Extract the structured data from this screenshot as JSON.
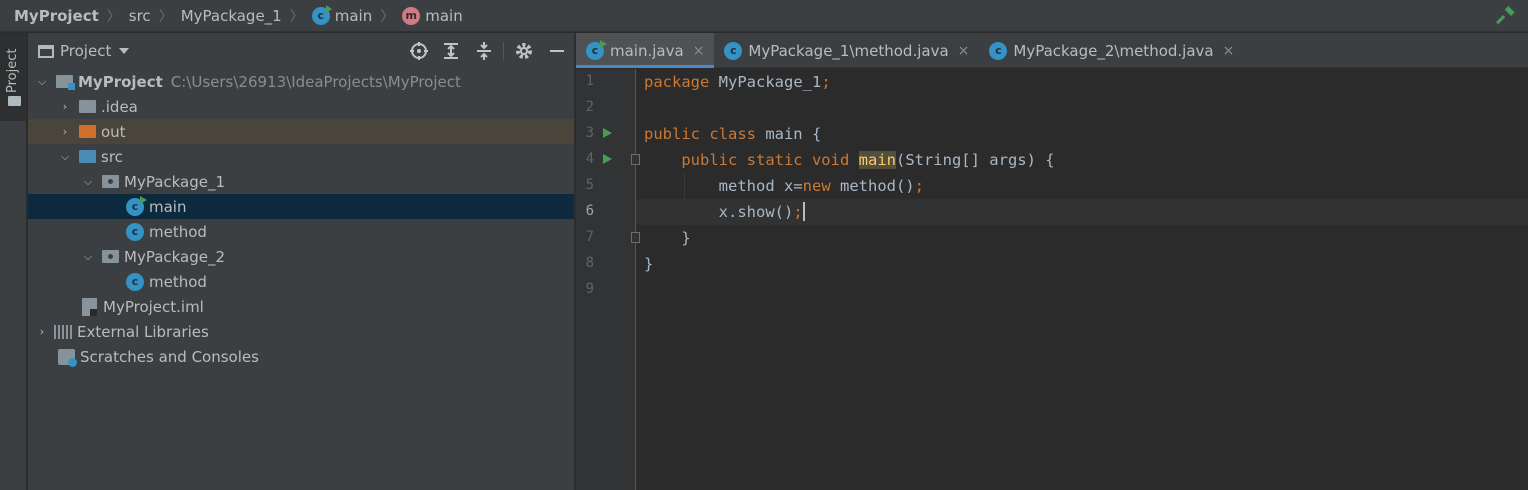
{
  "breadcrumb": {
    "project": "MyProject",
    "src": "src",
    "package": "MyPackage_1",
    "class_name": "main",
    "method_name": "main"
  },
  "sidebar_strip": {
    "label": "Project"
  },
  "project_panel": {
    "title": "Project",
    "tree": [
      {
        "label": "MyProject",
        "path": "C:\\Users\\26913\\IdeaProjects\\MyProject"
      },
      {
        "label": ".idea"
      },
      {
        "label": "out"
      },
      {
        "label": "src"
      },
      {
        "label": "MyPackage_1"
      },
      {
        "label": "main"
      },
      {
        "label": "method"
      },
      {
        "label": "MyPackage_2"
      },
      {
        "label": "method"
      },
      {
        "label": "MyProject.iml"
      },
      {
        "label": "External Libraries"
      },
      {
        "label": "Scratches and Consoles"
      }
    ]
  },
  "tabs": [
    {
      "label": "main.java",
      "close": "×"
    },
    {
      "label": "MyPackage_1\\method.java",
      "close": "×"
    },
    {
      "label": "MyPackage_2\\method.java",
      "close": "×"
    }
  ],
  "editor": {
    "line_numbers": [
      "1",
      "2",
      "3",
      "4",
      "5",
      "6",
      "7",
      "8",
      "9"
    ],
    "current_line": 6,
    "code": {
      "l1_kw": "package",
      "l1_rest": " MyPackage_1",
      "l1_semi": ";",
      "l3_kw": "public class",
      "l3_rest": " main {",
      "l4_indent": "    ",
      "l4_kw": "public static void",
      "l4_sp": " ",
      "l4_fn": "main",
      "l4_rest": "(String[] args) {",
      "l5_indent": "        ",
      "l5_a": "method x=",
      "l5_kw": "new",
      "l5_b": " method()",
      "l5_semi": ";",
      "l6_indent": "        ",
      "l6_a": "x.show()",
      "l6_semi": ";",
      "l7": "    }",
      "l8": "}"
    }
  },
  "colors": {
    "keyword": "#cc7832",
    "function": "#ffc66d",
    "text": "#a9b7c6",
    "class_icon": "#3592c4",
    "run_icon": "#499c54",
    "selection": "#0d293e",
    "tab_underline": "#4a88c7"
  }
}
